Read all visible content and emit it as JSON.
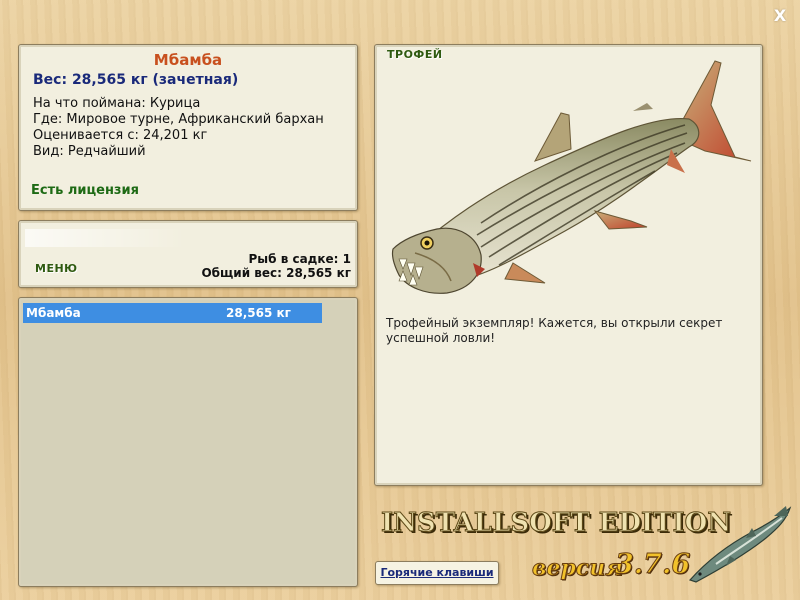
{
  "close_label": "X",
  "fish_info": {
    "name": "Мбамба",
    "weight_line": "Вес: 28,565 кг (зачетная)",
    "bait_line": "На что поймана: Курица",
    "location_line": "Где: Мировое турне, Африканский бархан",
    "value_line": "Оценивается с: 24,201 кг",
    "kind_line": "Вид: Редчайший",
    "license": "Есть лицензия"
  },
  "menu": {
    "menu_label": "МЕНЮ",
    "cage_count": "Рыб в садке: 1",
    "total_weight": "Общий вес: 28,565 кг"
  },
  "catch_list": [
    {
      "name": "Мбамба",
      "weight": "28,565 кг",
      "selected": true
    }
  ],
  "trophy": {
    "tag": "ТРОФЕЙ",
    "image_icon": "tigerfish-image",
    "description": "Трофейный экземпляр! Кажется, вы открыли секрет успешной ловли!"
  },
  "hotkeys_label": "Горячие клавиши",
  "logo": {
    "edition": "INSTALLSOFT EDITION",
    "version_word": "версия",
    "version_number": "3.7.6",
    "icon": "sturgeon-icon"
  },
  "colors": {
    "title_orange": "#c8501e",
    "weight_blue": "#1a2a7a",
    "license_green": "#1d6a14",
    "selection_blue": "#3e8ee2",
    "panel_bg": "#f2efdf"
  }
}
